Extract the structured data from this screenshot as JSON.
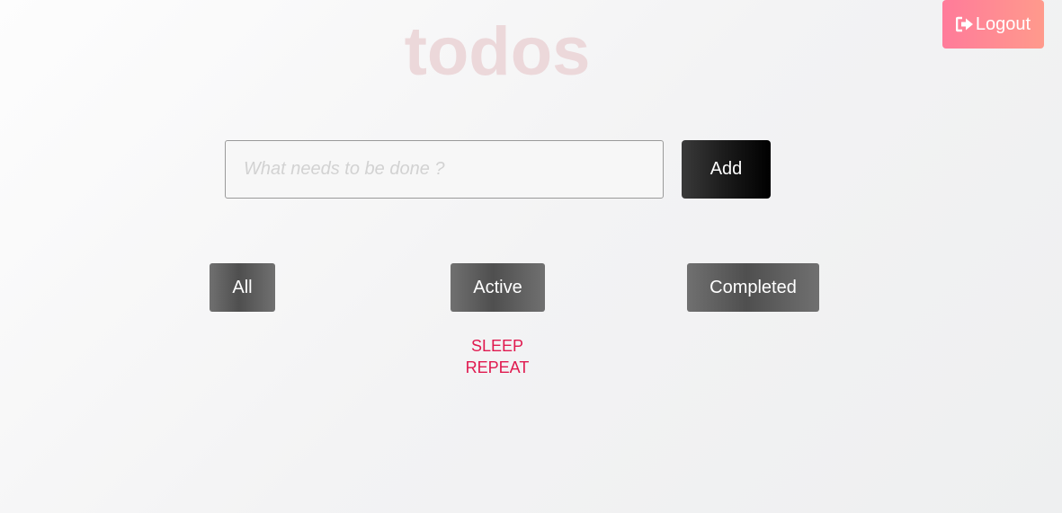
{
  "header": {
    "logout_label": "Logout",
    "logout_icon": "sign-out-icon"
  },
  "app": {
    "title": "todos"
  },
  "new_todo": {
    "placeholder": "What needs to be done ?",
    "value": "",
    "add_label": "Add"
  },
  "filters": {
    "all_label": "All",
    "active_label": "Active",
    "completed_label": "Completed"
  },
  "todos": {
    "items": [
      {
        "text": "SLEEP"
      },
      {
        "text": "REPEAT"
      }
    ]
  },
  "colors": {
    "title": "#ecd8da",
    "todo_text": "#e0194f",
    "logout_gradient_start": "#ff7b9a",
    "logout_gradient_end": "#ff9a8c",
    "add_button": "#000000",
    "filter_button": "#5a5a5a"
  }
}
